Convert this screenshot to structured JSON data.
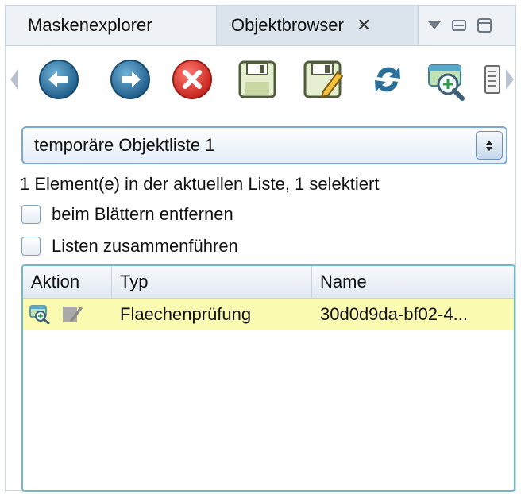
{
  "tabs": [
    {
      "label": "Maskenexplorer",
      "active": false
    },
    {
      "label": "Objektbrowser",
      "active": true
    }
  ],
  "icons": {
    "tab_close": "close-icon",
    "view_menu": "triangle-down-icon",
    "minimize": "minimize-icon",
    "maximize": "maximize-icon"
  },
  "toolbar": [
    {
      "name": "scroll-left-icon"
    },
    {
      "name": "back-icon"
    },
    {
      "name": "forward-icon"
    },
    {
      "name": "delete-icon"
    },
    {
      "name": "save-icon"
    },
    {
      "name": "save-as-icon"
    },
    {
      "name": "refresh-icon"
    },
    {
      "name": "zoom-map-icon"
    },
    {
      "name": "panel-icon"
    },
    {
      "name": "scroll-right-icon"
    }
  ],
  "list_select": {
    "value": "temporäre Objektliste 1"
  },
  "status_text": "1 Element(e) in der aktuellen Liste, 1 selektiert",
  "checkboxes": [
    {
      "label": "beim Blättern entfernen",
      "checked": false
    },
    {
      "label": "Listen zusammenführen",
      "checked": false
    }
  ],
  "table": {
    "columns": [
      "Aktion",
      "Typ",
      "Name"
    ],
    "rows": [
      {
        "typ": "Flaechenprüfung",
        "name": "30d0d9da-bf02-4...",
        "action_icons": [
          "zoom-map-icon",
          "edit-icon"
        ],
        "selected": true
      }
    ]
  },
  "colors": {
    "selection_row": "#fafab0",
    "table_border": "#6fb9c6",
    "combo_border": "#7aa9d6",
    "active_tab": "#dbe4ed"
  }
}
